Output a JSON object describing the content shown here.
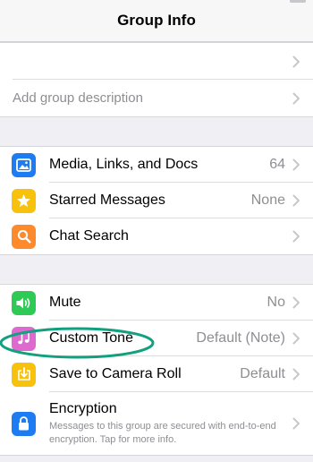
{
  "header": {
    "title": "Group Info"
  },
  "group_top": [
    {
      "text": ""
    },
    {
      "text": "Add group description"
    }
  ],
  "media_section": [
    {
      "label": "Media, Links, and Docs",
      "value": "64",
      "icon": "photo-icon",
      "color": "#1e7cf2"
    },
    {
      "label": "Starred Messages",
      "value": "None",
      "icon": "star-icon",
      "color": "#f7c10c"
    },
    {
      "label": "Chat Search",
      "value": "",
      "icon": "search-icon",
      "color": "#ff8a2b"
    }
  ],
  "settings_section": [
    {
      "label": "Mute",
      "value": "No",
      "icon": "speaker-icon",
      "color": "#2fca55"
    },
    {
      "label": "Custom Tone",
      "value": "Default (Note)",
      "icon": "music-note-icon",
      "color": "#de6ad0"
    },
    {
      "label": "Save to Camera Roll",
      "value": "Default",
      "icon": "save-download-icon",
      "color": "#f7c10c"
    }
  ],
  "encryption": {
    "label": "Encryption",
    "description": "Messages to this group are secured with end-to-end encryption. Tap for more info.",
    "icon": "lock-icon",
    "color": "#1e7cf2"
  },
  "annotation": {
    "shape": "ellipse",
    "color": "#12a07f"
  }
}
